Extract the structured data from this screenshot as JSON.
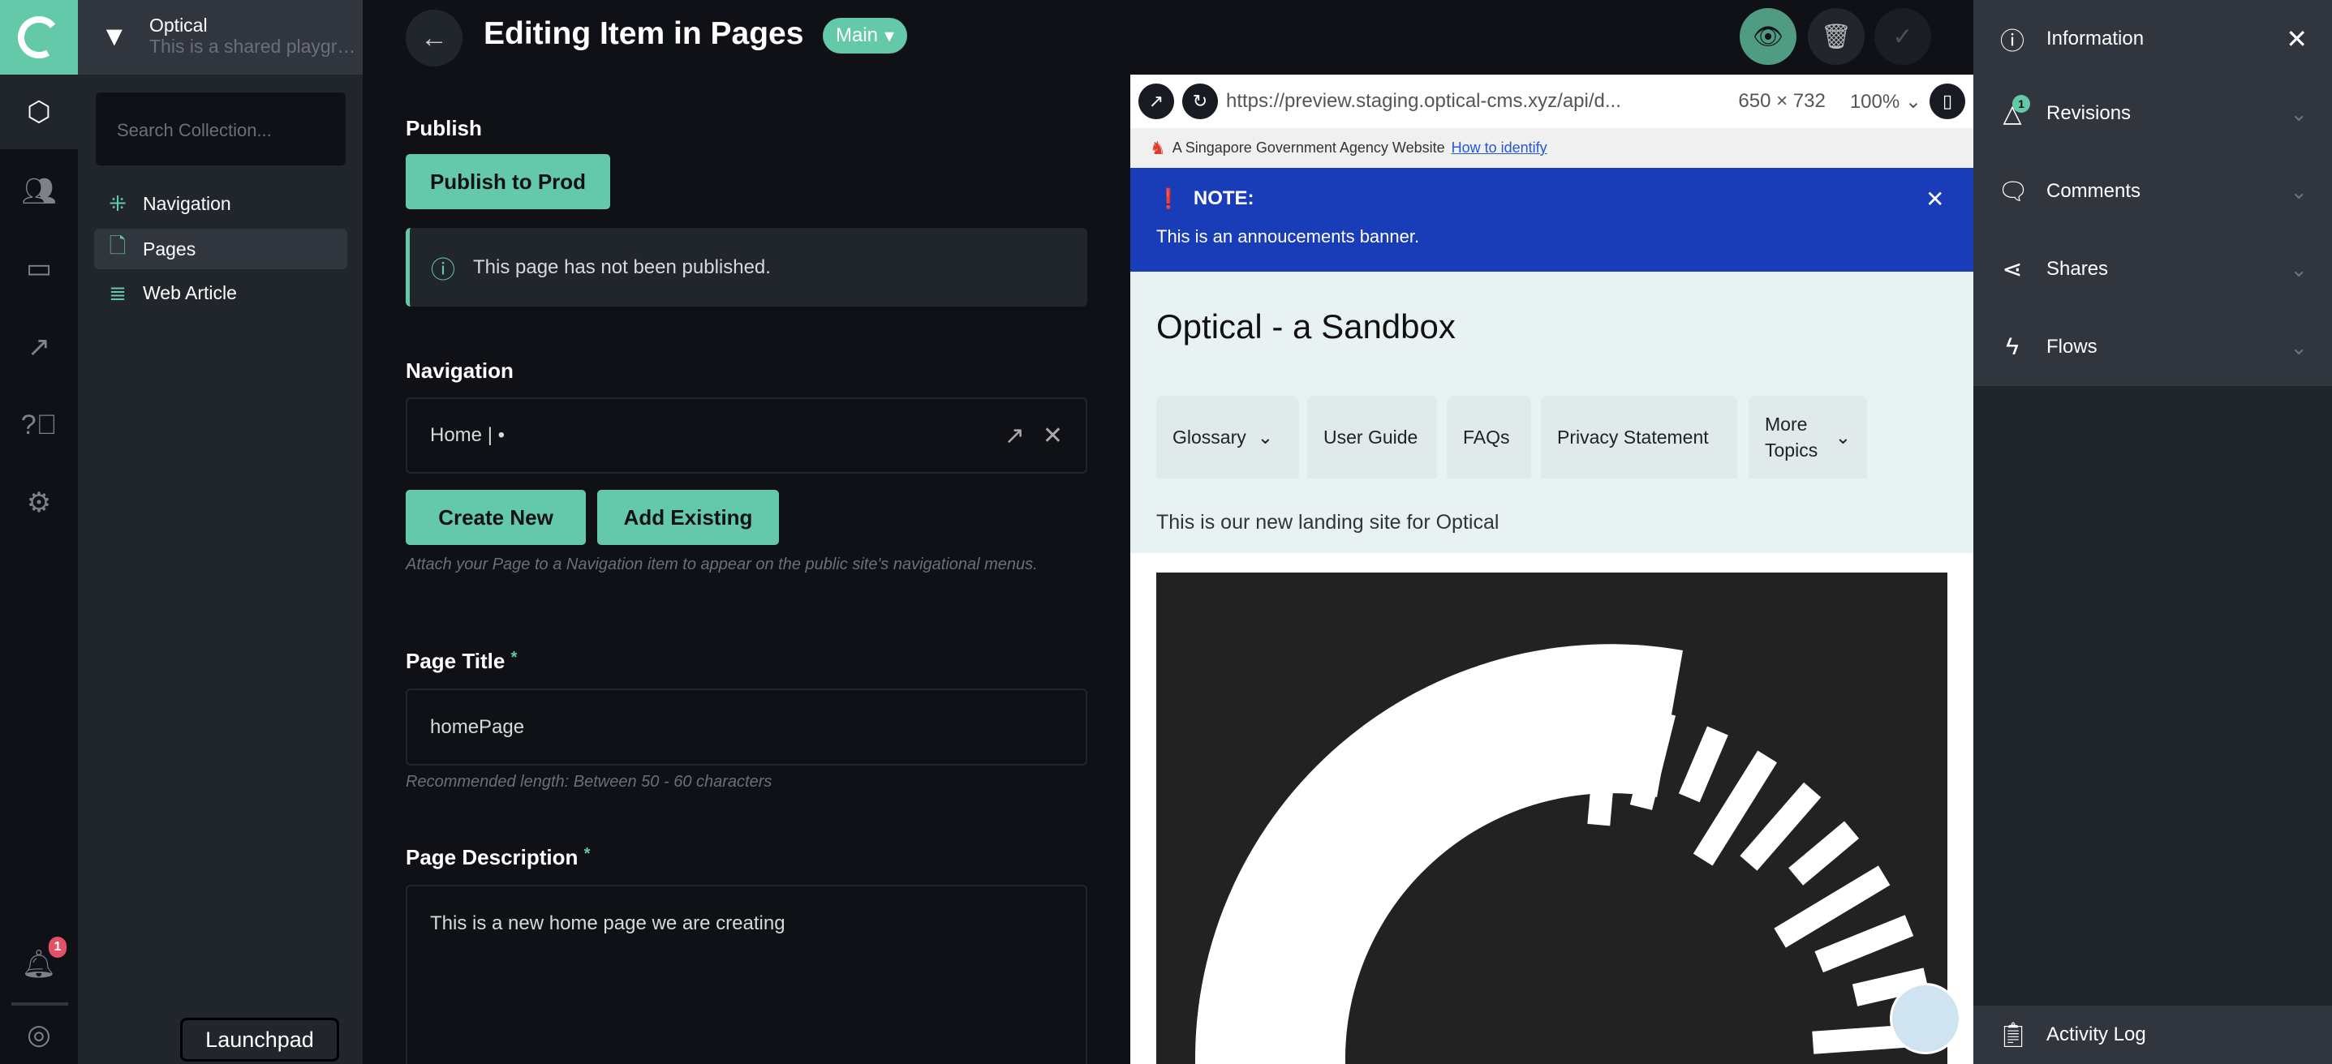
{
  "project": {
    "name": "Optical",
    "description": "This is a shared playground"
  },
  "rail": {
    "icons": [
      "cube-icon",
      "users-icon",
      "folder-icon",
      "insights-icon",
      "help-icon",
      "settings-icon"
    ],
    "notification_count": "1",
    "launchpad_tooltip": "Launchpad"
  },
  "sidebar": {
    "search_placeholder": "Search Collection...",
    "items": [
      {
        "label": "Navigation",
        "icon": "navigation-icon"
      },
      {
        "label": "Pages",
        "icon": "page-icon"
      },
      {
        "label": "Web Article",
        "icon": "database-icon"
      }
    ]
  },
  "header": {
    "title": "Editing Item in Pages",
    "branch": "Main"
  },
  "form": {
    "publish": {
      "label": "Publish",
      "button": "Publish to Prod",
      "notice": "This page has not been published."
    },
    "navigation": {
      "label": "Navigation",
      "value": "Home | •",
      "create_new": "Create New",
      "add_existing": "Add Existing",
      "hint": "Attach your Page to a Navigation item to appear on the public site's navigational menus."
    },
    "page_title": {
      "label": "Page Title",
      "required": "*",
      "value": "homePage",
      "hint": "Recommended length: Between 50 - 60 characters"
    },
    "page_description": {
      "label": "Page Description",
      "required": "*",
      "value": "This is a new home page we are creating"
    }
  },
  "preview": {
    "url": "https://preview.staging.optical-cms.xyz/api/d...",
    "dimensions": "650 × 732",
    "zoom": "100%",
    "masthead": {
      "text": "A Singapore Government Agency Website",
      "link": "How to identify"
    },
    "banner": {
      "title": "NOTE:",
      "text": "This is an annoucements banner."
    },
    "site_title": "Optical - a Sandbox",
    "nav": [
      "Glossary",
      "User Guide",
      "FAQs",
      "Privacy Statement",
      "More Topics"
    ],
    "intro": "This is our new landing site for Optical"
  },
  "right_panel": {
    "items": [
      {
        "label": "Information"
      },
      {
        "label": "Revisions",
        "badge": "1"
      },
      {
        "label": "Comments"
      },
      {
        "label": "Shares"
      },
      {
        "label": "Flows"
      }
    ],
    "activity_log": "Activity Log"
  },
  "colors": {
    "accent": "#63c9a8",
    "banner": "#193cb8",
    "danger": "#e35169"
  }
}
